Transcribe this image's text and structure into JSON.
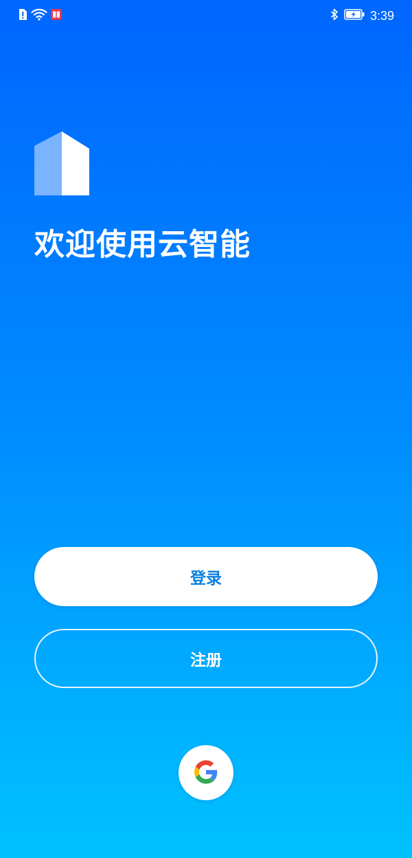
{
  "status_bar": {
    "time": "3:39",
    "icons": [
      "alert-icon",
      "wifi-icon",
      "notification-app-icon",
      "bluetooth-icon",
      "battery-icon"
    ]
  },
  "welcome": {
    "title": "欢迎使用云智能"
  },
  "actions": {
    "login_label": "登录",
    "register_label": "注册"
  },
  "social_login": {
    "provider_icon": "google-icon"
  },
  "colors": {
    "gradient_top": "#0066ff",
    "gradient_bottom": "#00c2ff",
    "login_text": "#0a7fe0"
  }
}
